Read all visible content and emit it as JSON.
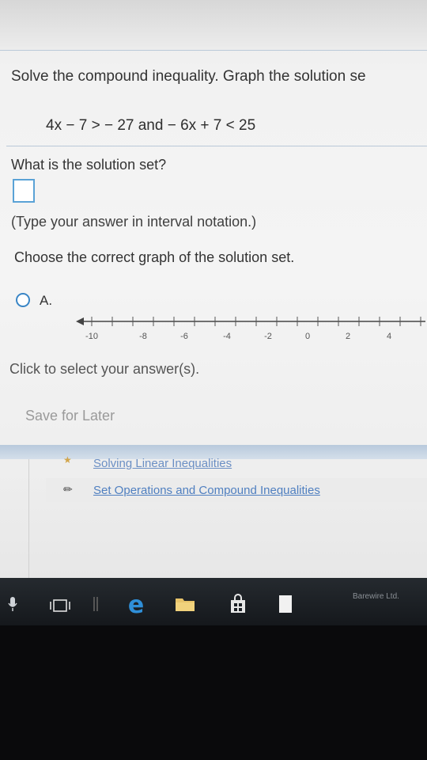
{
  "problem": {
    "instruction": "Solve the compound inequality. Graph the solution se",
    "equation": "4x − 7 > − 27 and − 6x + 7 < 25",
    "solution_prompt": "What is the solution set?",
    "answer_value": "",
    "hint": "(Type your answer in interval notation.)",
    "graph_prompt": "Choose the correct graph of the solution set."
  },
  "options": [
    {
      "label": "A.",
      "tick_labels": [
        "-10",
        "-8",
        "-6",
        "-4",
        "-2",
        "0",
        "2",
        "4"
      ]
    }
  ],
  "footer": {
    "click_hint": "Click to select your answer(s).",
    "save_label": "Save for Later"
  },
  "related": [
    {
      "title": "Solving Linear Inequalities",
      "icon": "star-icon"
    },
    {
      "title": "Set Operations and Compound Inequalities",
      "icon": "pencil-icon"
    }
  ],
  "taskbar": {
    "watermark": "Barewire Ltd."
  },
  "colors": {
    "accent": "#3a86c6",
    "link": "#4f7fc0",
    "taskbar": "#1c2025"
  }
}
